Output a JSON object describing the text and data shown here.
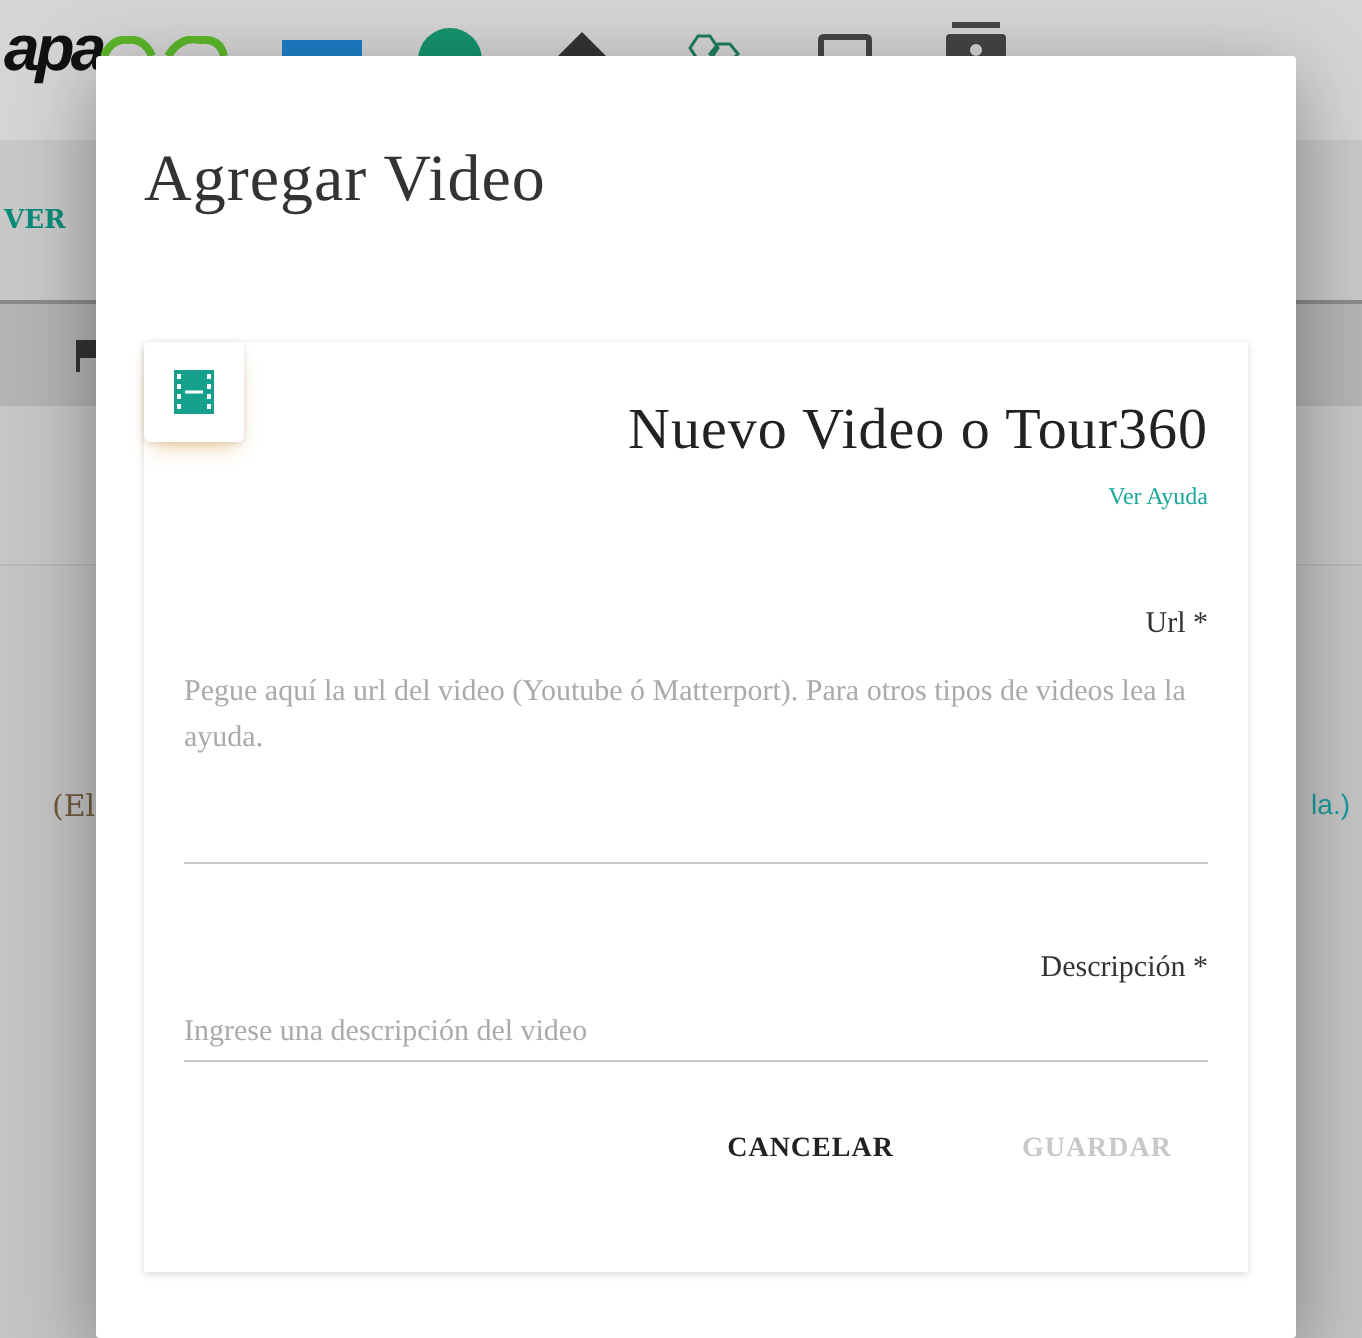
{
  "background": {
    "logo": [
      "apa"
    ],
    "nav_link": "VER",
    "note_start": "(El",
    "note_end": "la.)"
  },
  "dialog": {
    "title": "Agregar Video",
    "card": {
      "title": "Nuevo Video o Tour360",
      "help_link": "Ver Ayuda",
      "fields": [
        {
          "kind": "textarea",
          "label": "Url *",
          "placeholder": "Pegue aquí la url del video (Youtube ó Matterport). Para otros tipos de videos lea la ayuda."
        },
        {
          "kind": "input",
          "label": "Descripción *",
          "placeholder": "Ingrese una descripción del video"
        }
      ],
      "buttons": [
        {
          "label": "CANCELAR",
          "disabled": false
        },
        {
          "label": "GUARDAR",
          "disabled": true
        }
      ]
    }
  }
}
